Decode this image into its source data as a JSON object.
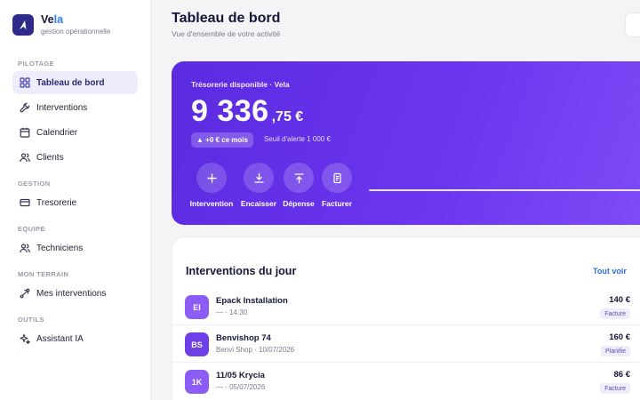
{
  "brand": {
    "name_start": "Ve",
    "name_accent": "la",
    "subtitle": "gestion opérationnelle"
  },
  "sidebar": {
    "sections": {
      "pilotage": "PILOTAGE",
      "gestion": "GESTION",
      "equipe": "EQUIPE",
      "terrain": "MON TERRAIN",
      "outils": "OUTILS"
    },
    "items": [
      {
        "label": "Tableau de bord",
        "icon": "grid-icon",
        "active": true
      },
      {
        "label": "Interventions",
        "icon": "wrench-icon"
      },
      {
        "label": "Calendrier",
        "icon": "calendar-icon"
      },
      {
        "label": "Clients",
        "icon": "users-icon"
      },
      {
        "label": "Tresorerie",
        "icon": "wallet-icon"
      },
      {
        "label": "Techniciens",
        "icon": "users-icon"
      },
      {
        "label": "Mes interventions",
        "icon": "route-icon"
      },
      {
        "label": "Assistant IA",
        "icon": "sparkle-icon"
      }
    ]
  },
  "header": {
    "title": "Tableau de bord",
    "subtitle": "Vue d'ensemble de votre activité"
  },
  "treasury": {
    "label": "Trésorerie disponible · Vela",
    "amount_int": "9 336",
    "amount_dec": ",75 €",
    "badge": "▲ +0 € ce mois",
    "alert": "Seuil d'alerte 1 000 €",
    "actions": [
      {
        "label": "Intervention",
        "icon": "plus-icon"
      },
      {
        "label": "Encaisser",
        "icon": "download-icon"
      },
      {
        "label": "Dépense",
        "icon": "upload-icon"
      },
      {
        "label": "Facturer",
        "icon": "document-icon"
      }
    ]
  },
  "interventions": {
    "title": "Interventions du jour",
    "see_all": "Tout voir",
    "rows": [
      {
        "initials": "EI",
        "name": "Epack Installation",
        "sub": "— · 14:30",
        "amount": "140 €",
        "tag": "Facture",
        "color": "#8b5cf6"
      },
      {
        "initials": "BS",
        "name": "Benvishop 74",
        "sub": "Benvi Shop · 10/07/2026",
        "amount": "160 €",
        "tag": "Planifie",
        "color": "#6d3fe6"
      },
      {
        "initials": "1K",
        "name": "11/05 Krycia",
        "sub": "— · 05/07/2026",
        "amount": "86 €",
        "tag": "Facture",
        "color": "#8b5cf6"
      }
    ]
  }
}
